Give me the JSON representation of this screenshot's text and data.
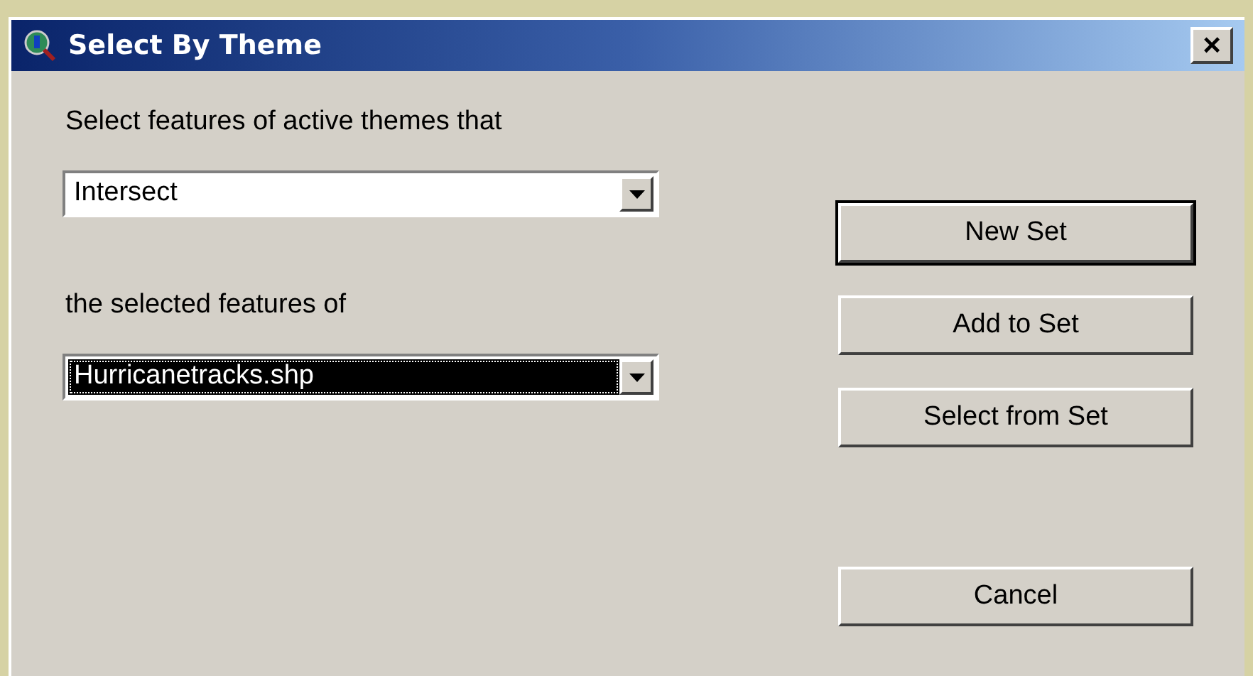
{
  "window": {
    "title": "Select By Theme",
    "close_label": "×"
  },
  "prompt": "Select features of active themes that",
  "dropdowns": [
    {
      "value": "Intersect",
      "focused": false
    },
    {
      "value": "Hurricanetracks.shp",
      "focused": true
    }
  ],
  "label_between": "the selected features of",
  "buttons": [
    {
      "label": "New Set",
      "default": true
    },
    {
      "label": "Add to Set",
      "default": false
    },
    {
      "label": "Select from Set",
      "default": false
    },
    {
      "label": "Cancel",
      "default": false
    }
  ]
}
